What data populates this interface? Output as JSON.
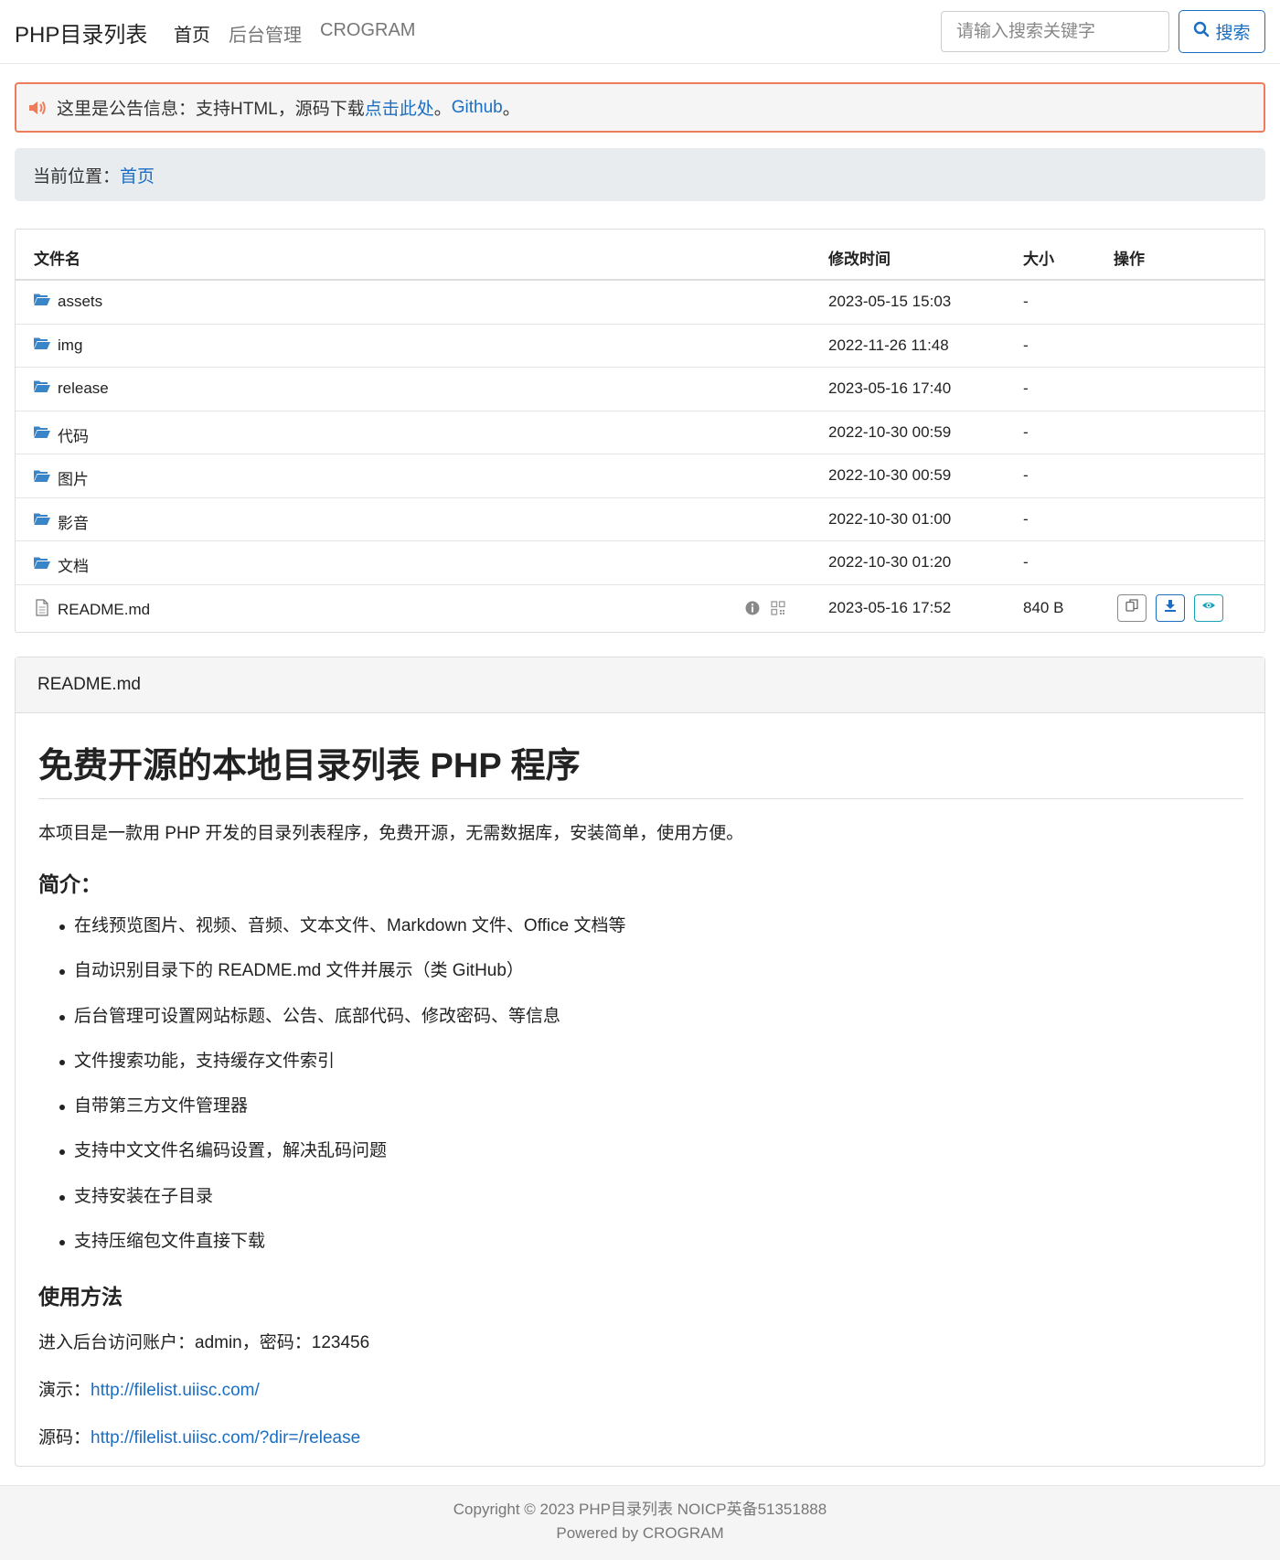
{
  "navbar": {
    "brand": "PHP目录列表",
    "links": [
      "首页",
      "后台管理",
      "CROGRAM"
    ],
    "search_placeholder": "请输入搜索关键字",
    "search_label": "搜索"
  },
  "notice": {
    "text": "这里是公告信息：支持HTML，源码下载 ",
    "link1": "点击此处",
    "sep": "。",
    "link2": "Github",
    "end": "。"
  },
  "breadcrumb": {
    "prefix": "当前位置：",
    "home": "首页"
  },
  "table": {
    "headers": {
      "name": "文件名",
      "time": "修改时间",
      "size": "大小",
      "ops": "操作"
    },
    "rows": [
      {
        "name": "assets",
        "time": "2023-05-15 15:03",
        "size": "-",
        "type": "folder"
      },
      {
        "name": "img",
        "time": "2022-11-26 11:48",
        "size": "-",
        "type": "folder"
      },
      {
        "name": "release",
        "time": "2023-05-16 17:40",
        "size": "-",
        "type": "folder"
      },
      {
        "name": "代码",
        "time": "2022-10-30 00:59",
        "size": "-",
        "type": "folder"
      },
      {
        "name": "图片",
        "time": "2022-10-30 00:59",
        "size": "-",
        "type": "folder"
      },
      {
        "name": "影音",
        "time": "2022-10-30 01:00",
        "size": "-",
        "type": "folder"
      },
      {
        "name": "文档",
        "time": "2022-10-30 01:20",
        "size": "-",
        "type": "folder"
      },
      {
        "name": "README.md",
        "time": "2023-05-16 17:52",
        "size": "840 B",
        "type": "file"
      }
    ]
  },
  "readme": {
    "filename": "README.md",
    "title": "免费开源的本地目录列表 PHP 程序",
    "intro": "本项目是一款用 PHP 开发的目录列表程序，免费开源，无需数据库，安装简单，使用方便。",
    "h2_features": "简介：",
    "features": [
      "在线预览图片、视频、音频、文本文件、Markdown 文件、Office 文档等",
      "自动识别目录下的 README.md 文件并展示（类 GitHub）",
      "后台管理可设置网站标题、公告、底部代码、修改密码、等信息",
      "文件搜索功能，支持缓存文件索引",
      "自带第三方文件管理器",
      "支持中文文件名编码设置，解决乱码问题",
      "支持安装在子目录",
      "支持压缩包文件直接下载"
    ],
    "h2_usage": "使用方法",
    "account": "进入后台访问账户：admin，密码：123456",
    "demo_label": "演示：",
    "demo_url": "http://filelist.uiisc.com/",
    "source_label": "源码：",
    "source_url": "http://filelist.uiisc.com/?dir=/release"
  },
  "footer": {
    "line1": "Copyright © 2023 PHP目录列表 NOICP英备51351888",
    "line2": "Powered by CROGRAM"
  },
  "colors": {
    "accent": "#1b6ec2",
    "notice_border": "#ee7b5a",
    "folder": "#3a84c8",
    "teal": "#17a2b8"
  }
}
